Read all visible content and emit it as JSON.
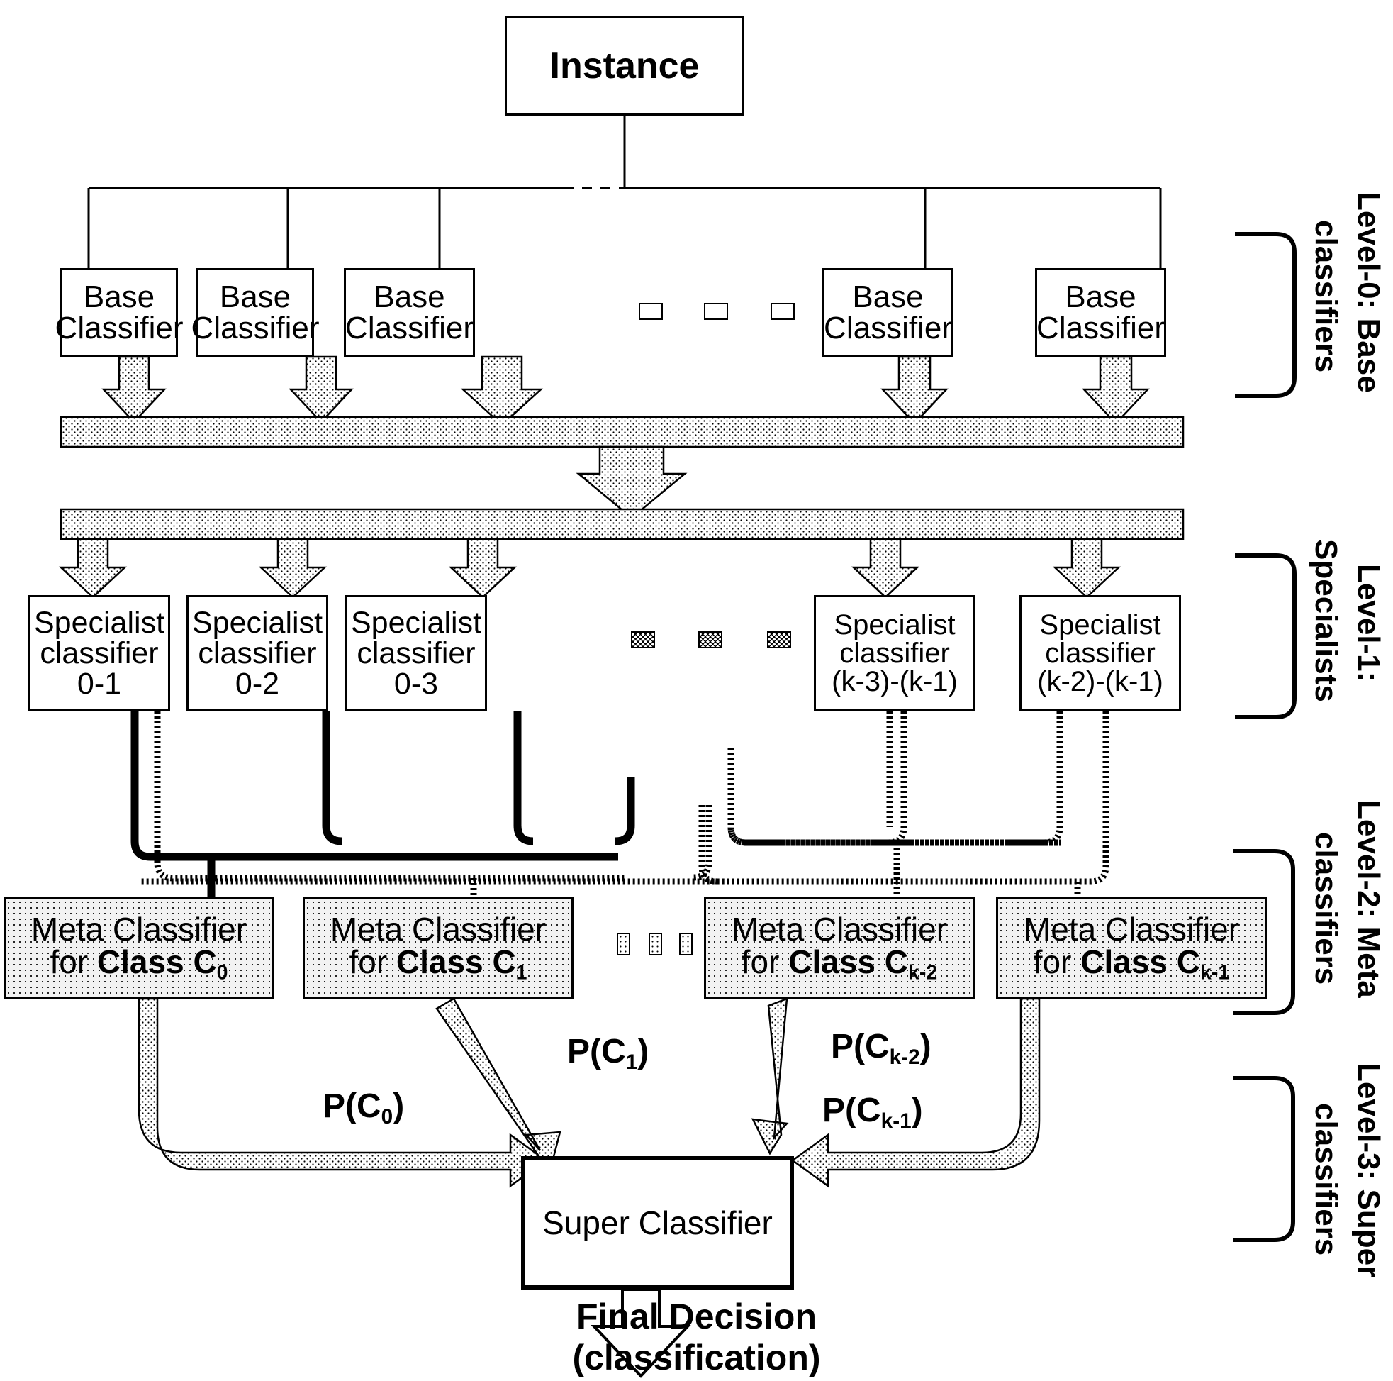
{
  "title": "Hierarchical ensemble classifier architecture",
  "nodes": {
    "instance": "Instance",
    "base_classifiers": [
      {
        "line1": "Base",
        "line2": "Classifier"
      },
      {
        "line1": "Base",
        "line2": "Classifier"
      },
      {
        "line1": "Base",
        "line2": "Classifier"
      },
      {
        "line1": "Base",
        "line2": "Classifier"
      },
      {
        "line1": "Base",
        "line2": "Classifier"
      }
    ],
    "specialist_classifiers": [
      {
        "line1": "Specialist",
        "line2": "classifier",
        "index": "0-1"
      },
      {
        "line1": "Specialist",
        "line2": "classifier",
        "index": "0-2"
      },
      {
        "line1": "Specialist",
        "line2": "classifier",
        "index": "0-3"
      },
      {
        "line1": "Specialist",
        "line2": "classifier",
        "index": "(k-3)-(k-1)"
      },
      {
        "line1": "Specialist",
        "line2": "classifier",
        "index": "(k-2)-(k-1)"
      }
    ],
    "meta_classifiers": [
      {
        "line1": "Meta Classifier",
        "prefix": "for ",
        "strong": "Class C",
        "sub": "0"
      },
      {
        "line1": "Meta Classifier",
        "prefix": "for ",
        "strong": "Class C",
        "sub": "1"
      },
      {
        "line1": "Meta Classifier",
        "prefix": "for ",
        "strong": "Class C",
        "sub": "k-2"
      },
      {
        "line1": "Meta Classifier",
        "prefix": "for ",
        "strong": "Class C",
        "sub": "k-1"
      }
    ],
    "super_classifier": "Super Classifier",
    "final_decision_line1": "Final Decision",
    "final_decision_line2": "(classification)"
  },
  "edge_labels": [
    {
      "base": "P(C",
      "sub": "0",
      "close": ")"
    },
    {
      "base": "P(C",
      "sub": "1",
      "close": ")"
    },
    {
      "base": "P(C",
      "sub": "k-2",
      "close": ")"
    },
    {
      "base": "P(C",
      "sub": "k-1",
      "close": ")"
    }
  ],
  "level_labels": [
    {
      "id": "level-0",
      "line1": "Level-0: Base",
      "line2": "classifiers"
    },
    {
      "id": "level-1",
      "line1": "Level-1:",
      "line2": "Specialists"
    },
    {
      "id": "level-2",
      "line1": "Level-2: Meta",
      "line2": "classifiers"
    },
    {
      "id": "level-3",
      "line1": "Level-3: Super",
      "line2": "classifiers"
    }
  ],
  "colors": {
    "stroke": "#000000",
    "background": "#ffffff",
    "meta_fill": "#f2f2f2",
    "bus_fill": "#ffffff"
  }
}
